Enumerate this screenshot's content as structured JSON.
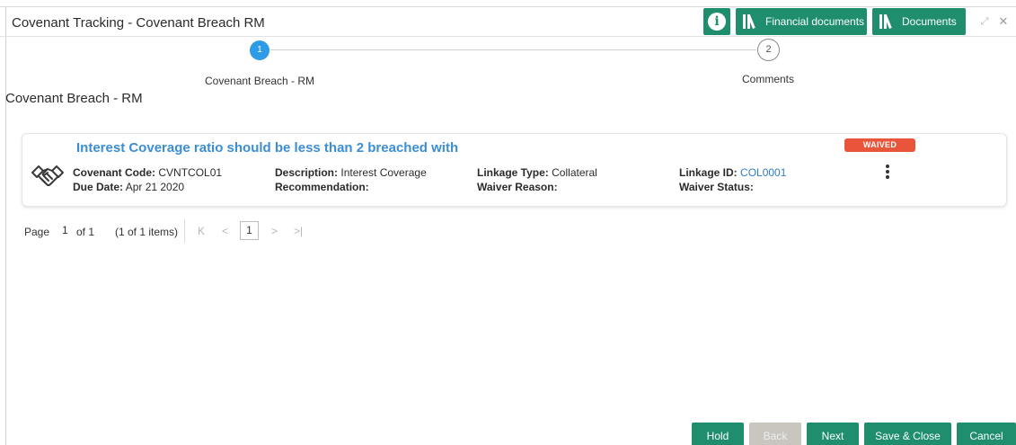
{
  "header": {
    "title": "Covenant Tracking - Covenant Breach RM",
    "info_glyph": "i",
    "financial_documents_label": "Financial documents",
    "documents_label": "Documents",
    "expand_glyph": "⤢",
    "close_glyph": "✕"
  },
  "stepper": {
    "steps": [
      {
        "number": "1",
        "label": "Covenant Breach - RM",
        "state": "active"
      },
      {
        "number": "2",
        "label": "Comments",
        "state": "inactive"
      }
    ]
  },
  "section_title": "Covenant Breach - RM",
  "card": {
    "title": "Interest Coverage ratio should be less than 2 breached with",
    "status": "WAIVED",
    "fields": {
      "covenant_code_label": "Covenant Code:",
      "covenant_code_value": "CVNTCOL01",
      "due_date_label": "Due Date:",
      "due_date_value": "Apr 21 2020",
      "description_label": "Description:",
      "description_value": "Interest Coverage",
      "recommendation_label": "Recommendation:",
      "recommendation_value": "",
      "linkage_type_label": "Linkage Type:",
      "linkage_type_value": "Collateral",
      "waiver_reason_label": "Waiver Reason:",
      "waiver_reason_value": "",
      "linkage_id_label": "Linkage ID:",
      "linkage_id_value": "COL0001",
      "waiver_status_label": "Waiver Status:",
      "waiver_status_value": ""
    }
  },
  "pager": {
    "page_label": "Page",
    "current_page": "1",
    "of_text": "of 1",
    "items_text": "(1 of 1 items)",
    "first_glyph": "K",
    "prev_glyph": "<",
    "next_glyph": ">",
    "last_glyph": ">|",
    "page_button": "1"
  },
  "footer": {
    "hold_label": "Hold",
    "back_label": "Back",
    "next_label": "Next",
    "save_close_label": "Save & Close",
    "cancel_label": "Cancel"
  },
  "colors": {
    "primary_green": "#1e8e6e",
    "active_step_blue": "#2e9be6",
    "title_blue": "#3b8ed4",
    "waived_red": "#e8553a",
    "disabled_grey": "#c9c6bf"
  },
  "icons": [
    "info-icon",
    "library-icon",
    "expand-icon",
    "close-icon",
    "handshake-icon",
    "more-vertical-icon"
  ]
}
